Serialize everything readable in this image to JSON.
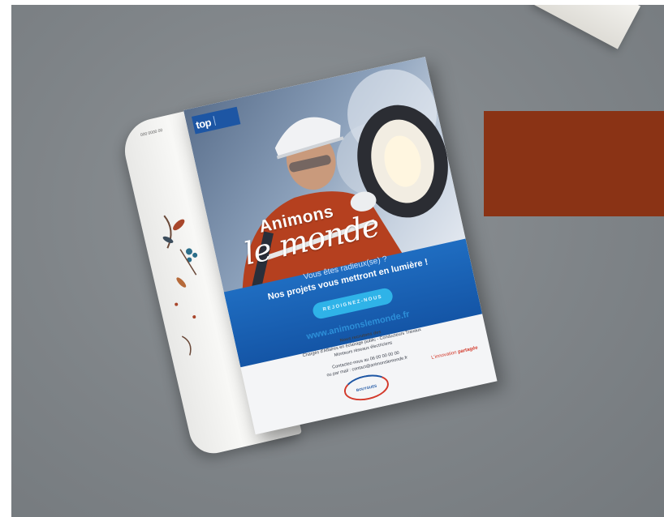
{
  "left_page": {
    "code": "000 0000 00"
  },
  "ad": {
    "logo": "top",
    "headline_1": "Animons",
    "headline_2": "le monde",
    "tagline_1": "Vous êtes radieux(se) ?",
    "tagline_2": "Nos projets vous mettront en lumière !",
    "cta": "REJOIGNEZ-NOUS",
    "url": "www.animonslemonde.fr",
    "recruit_title": "Nous recrutons des",
    "recruit_line_2": "Chargés d'Affaires en éclairage public - Conducteurs Travaux",
    "recruit_line_3": "Monteurs réseaux électriciens",
    "contact_1": "Contactez-nous au 06 00 00 00 00",
    "contact_2": "ou par mail : contact@animonslemonde.fr",
    "brand": "BOUYGUES",
    "partner_prefix": "L'innovation",
    "partner_bold": "partagée"
  },
  "colors": {
    "background": "#7f8488",
    "rust": "#8a3315",
    "brand_blue": "#1d56a4",
    "band_blue": "#1455a6",
    "cta_blue": "#2fb3e8",
    "accent_red": "#d33a2c"
  }
}
